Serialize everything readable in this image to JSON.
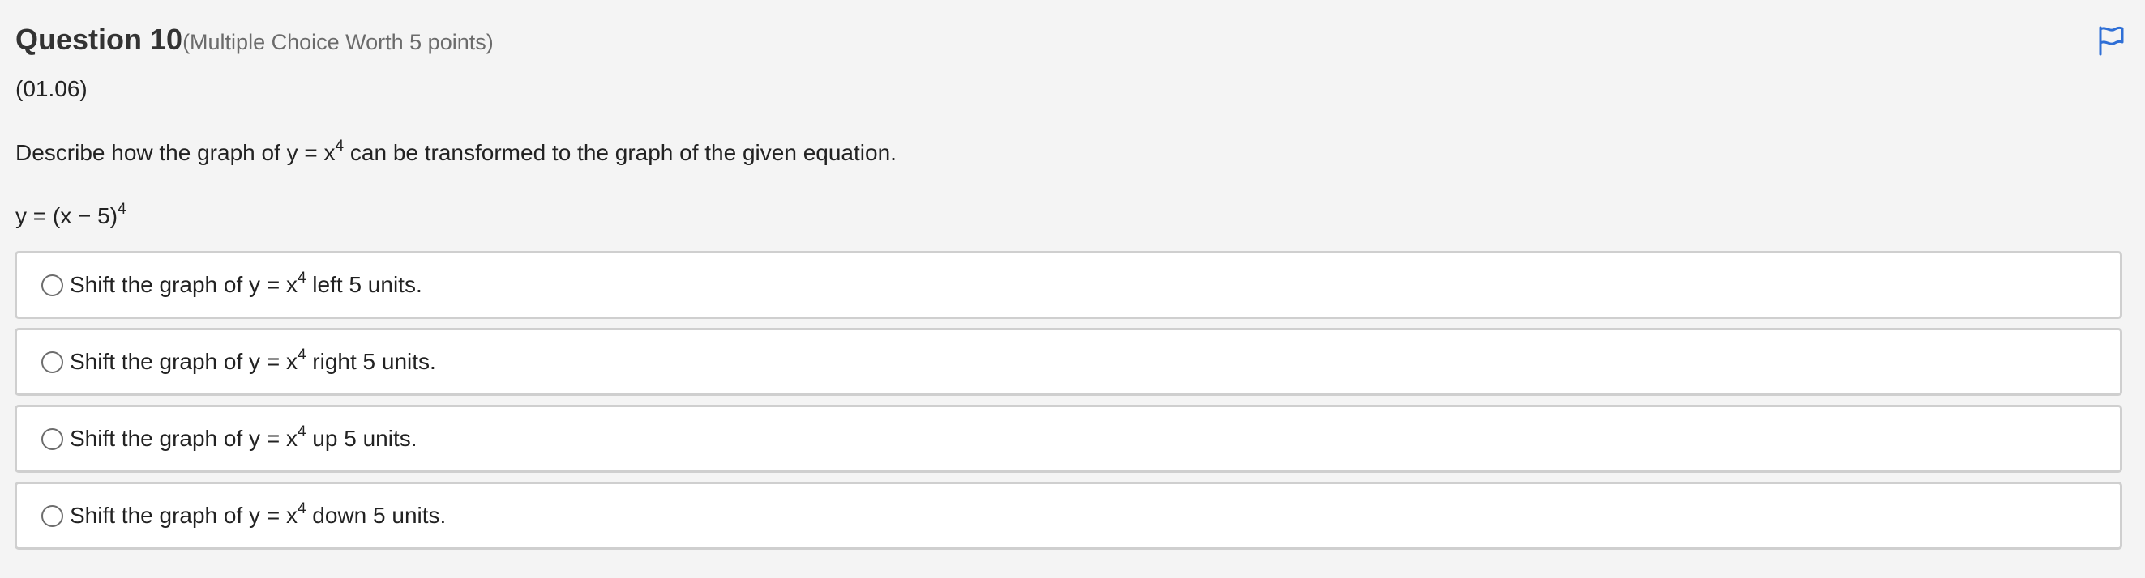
{
  "question": {
    "title": "Question 10",
    "meta": "(Multiple Choice Worth 5 points)",
    "code": "(01.06)",
    "prompt_before": "Describe how the graph of y = x",
    "prompt_exp": "4",
    "prompt_after": " can be transformed to the graph of the given equation.",
    "equation_base": "y = (x − 5)",
    "equation_exp": "4",
    "flag_icon": "flag-icon",
    "accent_color": "#2f6fd6"
  },
  "choices": [
    {
      "before": "Shift the graph of y = x",
      "exp": "4",
      "after": " left 5 units."
    },
    {
      "before": "Shift the graph of y = x",
      "exp": "4",
      "after": " right 5 units."
    },
    {
      "before": "Shift the graph of y = x",
      "exp": "4",
      "after": " up 5 units."
    },
    {
      "before": "Shift the graph of y = x",
      "exp": "4",
      "after": " down 5 units."
    }
  ]
}
